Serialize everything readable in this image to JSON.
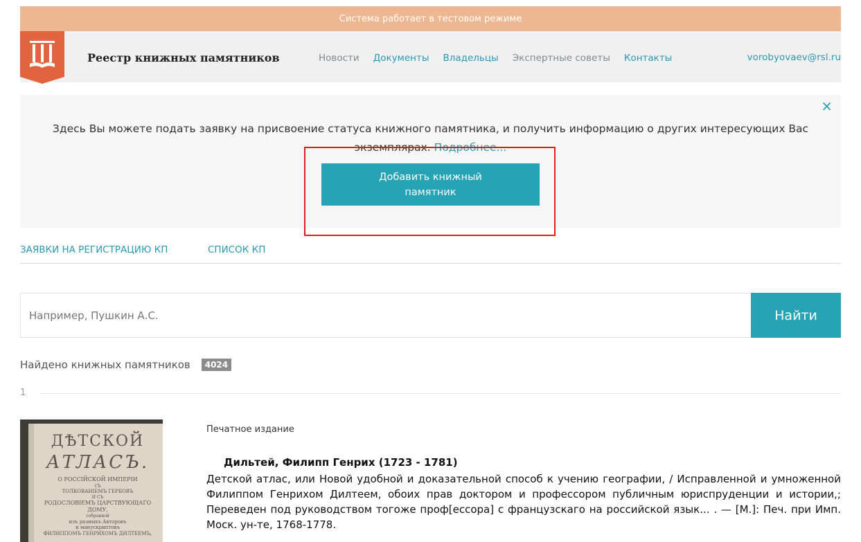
{
  "test_banner": "Система работает в тестовом режиме",
  "header": {
    "brand": "Реестр книжных памятников",
    "nav": [
      "Новости",
      "Документы",
      "Владельцы",
      "Экспертные советы",
      "Контакты"
    ],
    "user_email": "vorobyovaev@rsl.ru",
    "logo_icon": "book-columns-logo-icon"
  },
  "info": {
    "text_main": "Здесь Вы можете подать заявку на присвоение статуса книжного памятника, и получить информацию о других интересующих Вас экземплярах.",
    "text_link": "Подробнее...",
    "close": "×",
    "add_button_line1": "Добавить книжный",
    "add_button_line2": "памятник"
  },
  "tabs": [
    "ЗАЯВКИ НА РЕГИСТРАЦИЮ КП",
    "СПИСОК КП"
  ],
  "search": {
    "placeholder": "Например, Пушкин А.С.",
    "button": "Найти"
  },
  "results": {
    "found_label": "Найдено книжных памятников",
    "count": "4024",
    "page": "1"
  },
  "item": {
    "type": "Печатное издание",
    "author": "Дильтей, Филипп Генрих (1723 - 1781)",
    "description": "Детской атлас, или Новой удобной и доказательной способ к учению географии, / Исправленной и умноженной Филиппом Генрихом Дилтеем, обоих прав доктором и профессором публичным юриспруденции и истории,; Переведен под руководством тогоже проф[ессора] с французскаго на российской язык... . — [М.]: Печ. при Имп. Моск. ун-те, 1768-1778.",
    "cover_lines": [
      "ДѢТСКОЙ",
      "АТЛАСЪ.",
      "О РОССІЙСКОЙ ИМПЕРІИ",
      "СЪ",
      "ТОЛКОВАНІЕМЪ ГЕРБОВЪ",
      "И СЪ",
      "РОДОСЛОВІЕМЪ ЦАРСТВУЮЩАГО",
      "ДОМУ,",
      "собранной",
      "изъ разныхъ Авторовъ",
      "и манускриптовъ",
      "ФИЛИППОМЪ ГЕНРИХОМЪ ДИЛТЕЕМЪ,"
    ]
  },
  "colors": {
    "accent": "#26a3b4",
    "link": "#2a99b0",
    "banner": "#ecb791",
    "logo": "#e0643d",
    "highlight": "#e01b1b"
  }
}
